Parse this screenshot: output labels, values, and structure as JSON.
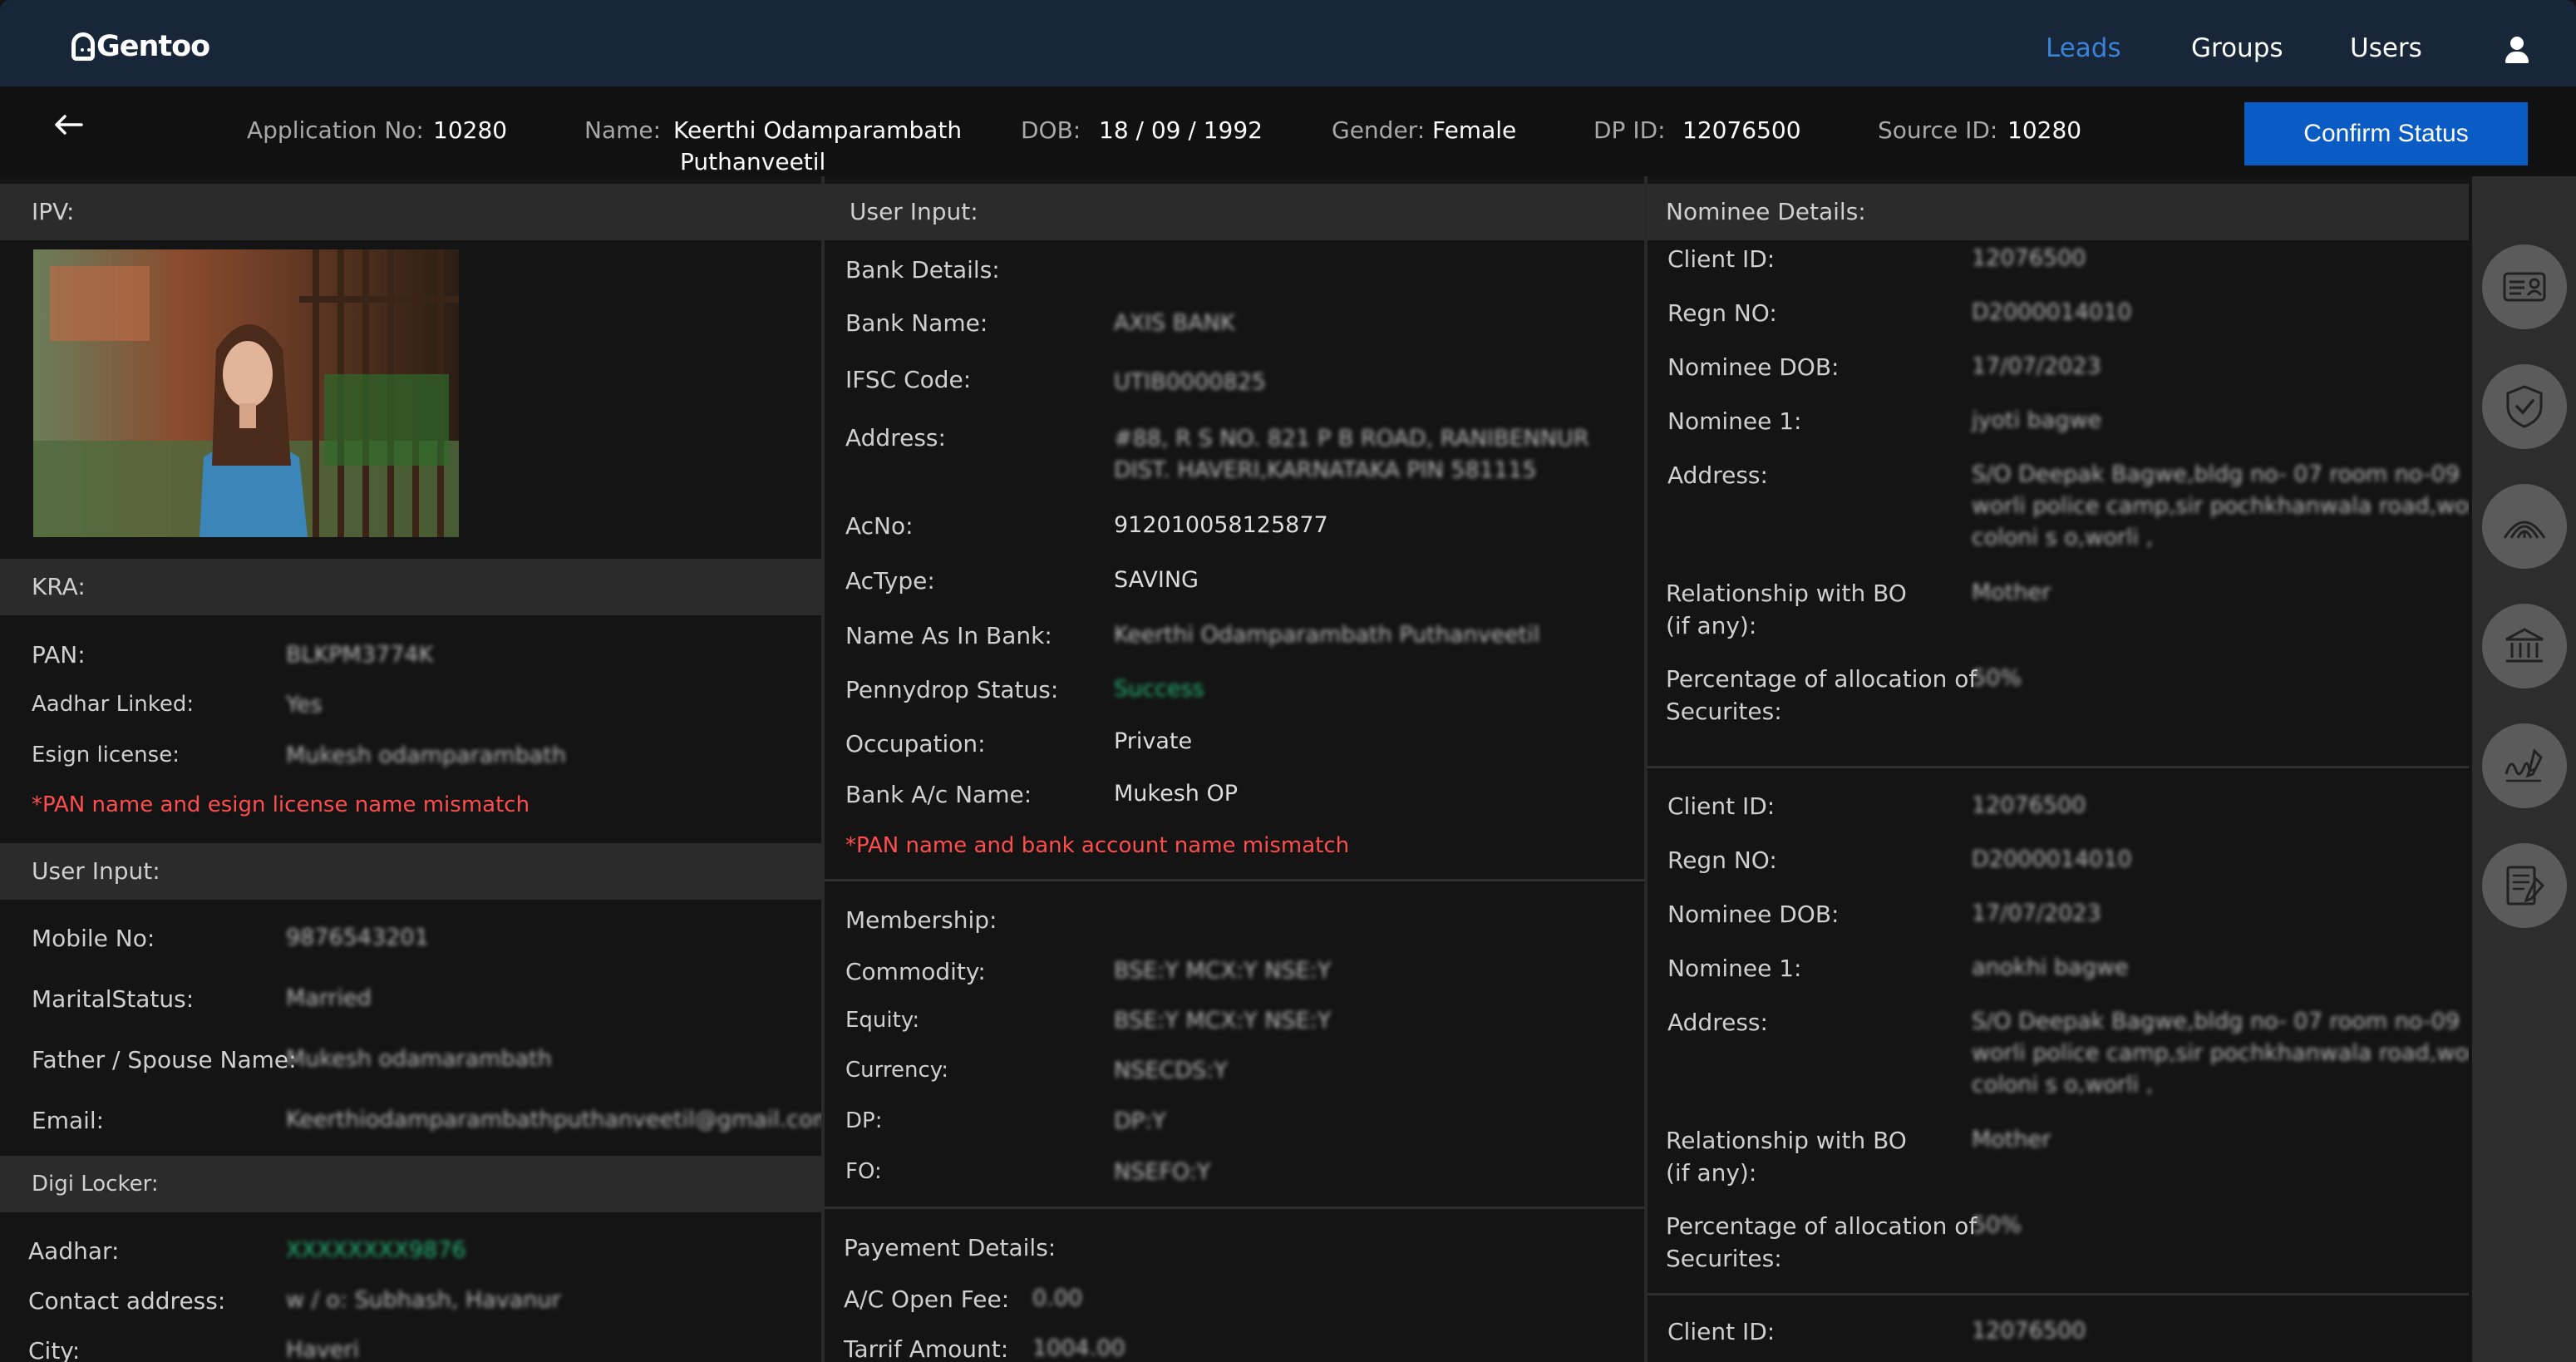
{
  "brand": {
    "name": "Gentoo"
  },
  "nav": {
    "leads": "Leads",
    "groups": "Groups",
    "users": "Users"
  },
  "header": {
    "app_no_label": "Application No:",
    "app_no": "10280",
    "name_label": "Name:",
    "name_line1": "Keerthi Odamparambath",
    "name_line2": "Puthanveetil",
    "dob_label": "DOB:",
    "dob": "18 / 09 / 1992",
    "gender_label": "Gender:",
    "gender": "Female",
    "dpid_label": "DP ID:",
    "dpid": "12076500",
    "source_label": "Source ID:",
    "source": "10280",
    "confirm": "Confirm Status"
  },
  "col1": {
    "ipv_title": "IPV:",
    "kra_title": "KRA:",
    "kra": [
      {
        "label": "PAN:",
        "value": "BLKPM3774K"
      },
      {
        "label": "Aadhar Linked:",
        "value": "Yes"
      },
      {
        "label": "Esign license:",
        "value": "Mukesh odamparambath"
      }
    ],
    "kra_error": "*PAN name and esign license name mismatch",
    "ui_title": "User Input:",
    "user_input": [
      {
        "label": "Mobile No:",
        "value": "9876543201"
      },
      {
        "label": "MaritalStatus:",
        "value": "Married"
      },
      {
        "label": "Father / Spouse Name:",
        "value": "Mukesh odamarambath"
      },
      {
        "label": "Email:",
        "value": "Keerthiodamparambathputhanveetil@gmail.com"
      }
    ],
    "digi_title": "Digi Locker:",
    "digi": [
      {
        "label": "Aadhar:",
        "value": "XXXXXXXX9876"
      },
      {
        "label": "Contact address:",
        "value": "w / o: Subhash, Havanur"
      },
      {
        "label": "City:",
        "value": "Haveri"
      }
    ]
  },
  "col2": {
    "title": "User Input:",
    "bank_title": "Bank Details:",
    "bank": [
      {
        "label": "Bank Name:",
        "value": "AXIS BANK"
      },
      {
        "label": "IFSC Code:",
        "value": "UTIB0000825"
      },
      {
        "label": "Address:",
        "value": "#88, R S NO. 821 P B ROAD, RANIBENNUR",
        "value2": "DIST. HAVERI,KARNATAKA PIN 581115"
      },
      {
        "label": "AcNo:",
        "value": "912010058125877"
      },
      {
        "label": "AcType:",
        "value": "SAVING"
      },
      {
        "label": "Name As In Bank:",
        "value": "Keerthi Odamparambath Puthanveetil"
      },
      {
        "label": "Pennydrop Status:",
        "value": "Success"
      },
      {
        "label": "Occupation:",
        "value": "Private"
      },
      {
        "label": "Bank A/c Name:",
        "value": "Mukesh OP"
      }
    ],
    "bank_error": "*PAN name and bank account name mismatch",
    "member_title": "Membership:",
    "membership": [
      {
        "label": "Commodity:",
        "value": "BSE:Y  MCX:Y  NSE:Y"
      },
      {
        "label": "Equity:",
        "value": "BSE:Y  MCX:Y  NSE:Y"
      },
      {
        "label": "Currency:",
        "value": "NSECDS:Y"
      },
      {
        "label": "DP:",
        "value": "DP:Y"
      },
      {
        "label": "FO:",
        "value": "NSEFO:Y"
      }
    ],
    "pay_title": "Payement Details:",
    "payment": [
      {
        "label": "A/C Open Fee:",
        "value": "0.00"
      },
      {
        "label": "Tarrif Amount:",
        "value": "1004.00"
      }
    ]
  },
  "col3": {
    "title": "Nominee Details:",
    "nominees": [
      {
        "client_label": "Client ID:",
        "client": "12076500",
        "regn_label": "Regn NO:",
        "regn": "D2000014010",
        "dob_label": "Nominee DOB:",
        "dob": "17/07/2023",
        "name_label": "Nominee 1:",
        "name": "jyoti bagwe",
        "addr_label": "Address:",
        "addr1": "S/O Deepak Bagwe,bldg no- 07 room no-09",
        "addr2": "worli police camp,sir pochkhanwala road,worli",
        "addr3": "coloni s o,worli ,",
        "rel_label1": "Relationship with BO",
        "rel_label2": "(if any):",
        "rel": "Mother",
        "pct_label1": "Percentage of allocation of",
        "pct_label2": "Securites:",
        "pct": "50%"
      },
      {
        "client_label": "Client ID:",
        "client": "12076500",
        "regn_label": "Regn NO:",
        "regn": "D2000014010",
        "dob_label": "Nominee DOB:",
        "dob": "17/07/2023",
        "name_label": "Nominee 1:",
        "name": "anokhi bagwe",
        "addr_label": "Address:",
        "addr1": "S/O Deepak Bagwe,bldg no- 07 room no-09",
        "addr2": "worli police camp,sir pochkhanwala road,worli",
        "addr3": "coloni s o,worli ,",
        "rel_label1": "Relationship with BO",
        "rel_label2": "(if any):",
        "rel": "Mother",
        "pct_label1": "Percentage of allocation of",
        "pct_label2": "Securites:",
        "pct": "50%"
      },
      {
        "client_label": "Client ID:",
        "client": "12076500"
      }
    ]
  },
  "rail_icons": [
    "id-card-icon",
    "shield-check-icon",
    "fingerprint-icon",
    "bank-icon",
    "signature-icon",
    "document-sign-icon"
  ],
  "colors": {
    "nav_bg": "#172638",
    "accent": "#0a5bc4",
    "active_link": "#3a82d6",
    "error": "#ff4d4d",
    "success": "#23b37a"
  }
}
